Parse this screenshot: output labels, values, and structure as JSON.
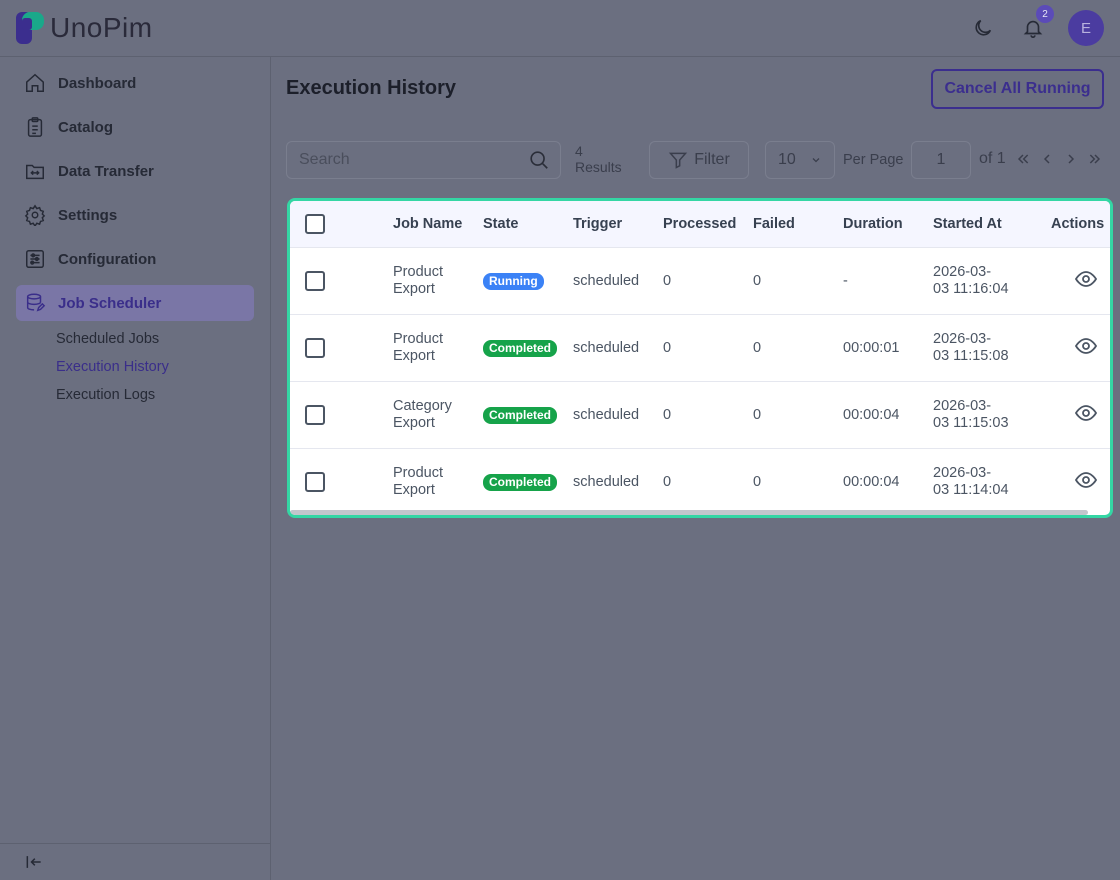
{
  "app": {
    "logo_text": "UnoPim",
    "notification_count": "2",
    "avatar_initial": "E"
  },
  "sidebar": {
    "items": [
      {
        "label": "Dashboard",
        "icon": "home-icon"
      },
      {
        "label": "Catalog",
        "icon": "clipboard-list-icon"
      },
      {
        "label": "Data Transfer",
        "icon": "folder-transfer-icon"
      },
      {
        "label": "Settings",
        "icon": "gear-icon"
      },
      {
        "label": "Configuration",
        "icon": "sliders-icon"
      },
      {
        "label": "Job Scheduler",
        "icon": "database-edit-icon",
        "active": true
      }
    ],
    "subitems": [
      {
        "label": "Scheduled Jobs"
      },
      {
        "label": "Execution History",
        "active": true
      },
      {
        "label": "Execution Logs"
      }
    ]
  },
  "main": {
    "title": "Execution History",
    "cancel_label": "Cancel All Running",
    "search_placeholder": "Search",
    "results_count": "4",
    "results_label": "Results",
    "filter_label": "Filter",
    "per_page_value": "10",
    "per_page_label": "Per Page",
    "page_value": "1",
    "page_of": "of 1"
  },
  "table": {
    "headers": [
      "Job Name",
      "State",
      "Trigger",
      "Processed",
      "Failed",
      "Duration",
      "Started At",
      "Actions"
    ],
    "rows": [
      {
        "job_line1": "Product",
        "job_line2": "Export",
        "state": "Running",
        "trigger": "scheduled",
        "processed": "0",
        "failed": "0",
        "duration": "-",
        "started_line1": "2026-03-",
        "started_line2": "03 11:16:04"
      },
      {
        "job_line1": "Product",
        "job_line2": "Export",
        "state": "Completed",
        "trigger": "scheduled",
        "processed": "0",
        "failed": "0",
        "duration": "00:00:01",
        "started_line1": "2026-03-",
        "started_line2": "03 11:15:08"
      },
      {
        "job_line1": "Category",
        "job_line2": "Export",
        "state": "Completed",
        "trigger": "scheduled",
        "processed": "0",
        "failed": "0",
        "duration": "00:00:04",
        "started_line1": "2026-03-",
        "started_line2": "03 11:15:03"
      },
      {
        "job_line1": "Product",
        "job_line2": "Export",
        "state": "Completed",
        "trigger": "scheduled",
        "processed": "0",
        "failed": "0",
        "duration": "00:00:04",
        "started_line1": "2026-03-",
        "started_line2": "03 11:14:04"
      }
    ]
  },
  "colors": {
    "accent": "#3b2e8e",
    "running": "#3b82f6",
    "completed": "#16a34a",
    "highlight": "#34d6a4"
  }
}
